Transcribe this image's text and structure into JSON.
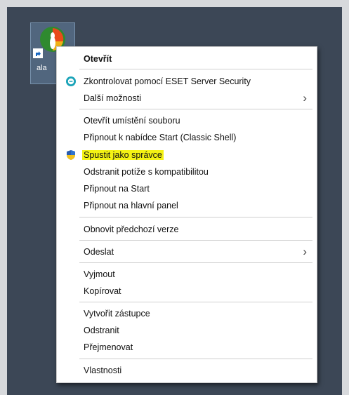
{
  "desktop_icon": {
    "label": "ala"
  },
  "context_menu": {
    "items": [
      {
        "label": "Otevřít"
      },
      {
        "label": "Zkontrolovat pomocí ESET Server Security"
      },
      {
        "label": "Další možnosti"
      },
      {
        "label": "Otevřít umístění souboru"
      },
      {
        "label": "Připnout k nabídce Start (Classic Shell)"
      },
      {
        "label": "Spustit jako správce"
      },
      {
        "label": "Odstranit potíže s kompatibilitou"
      },
      {
        "label": "Připnout na Start"
      },
      {
        "label": "Připnout na hlavní panel"
      },
      {
        "label": "Obnovit předchozí verze"
      },
      {
        "label": "Odeslat"
      },
      {
        "label": "Vyjmout"
      },
      {
        "label": "Kopírovat"
      },
      {
        "label": "Vytvořit zástupce"
      },
      {
        "label": "Odstranit"
      },
      {
        "label": "Přejmenovat"
      },
      {
        "label": "Vlastnosti"
      }
    ]
  },
  "icons": {
    "eset": "eset-icon",
    "uac_shield": "uac-shield-icon",
    "submenu_arrow": "chevron-right-icon",
    "shortcut": "shortcut-arrow-icon"
  },
  "colors": {
    "highlight": "#f4f214",
    "desktop": "#3c4756"
  }
}
